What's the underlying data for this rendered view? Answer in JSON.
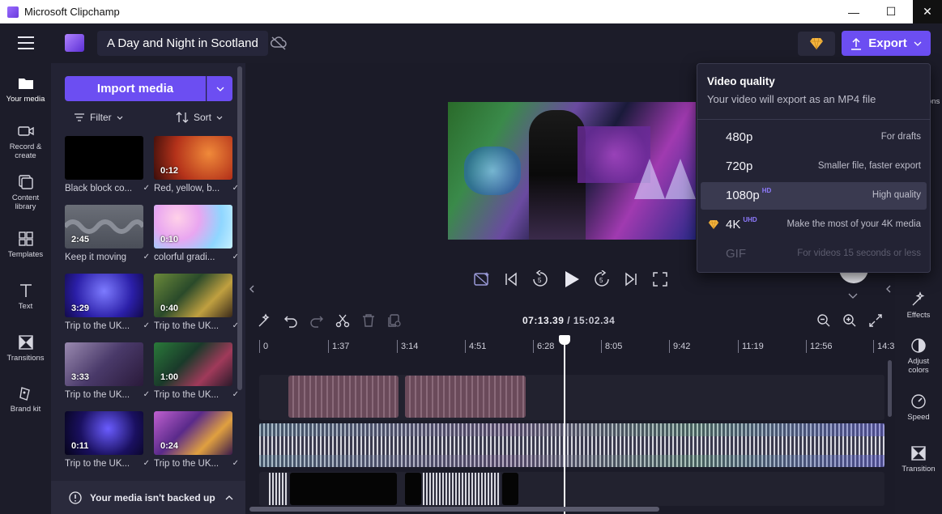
{
  "window": {
    "title": "Microsoft Clipchamp",
    "minimize_glyph": "—",
    "maximize_glyph": "☐",
    "close_glyph": "✕"
  },
  "header": {
    "project_title": "A Day and Night in Scotland",
    "export_label": "Export"
  },
  "leftnav": {
    "items": [
      {
        "label": "Your media",
        "icon": "folder-icon"
      },
      {
        "label": "Record & create",
        "icon": "camera-icon"
      },
      {
        "label": "Content library",
        "icon": "library-icon"
      },
      {
        "label": "Templates",
        "icon": "templates-icon"
      },
      {
        "label": "Text",
        "icon": "text-icon"
      },
      {
        "label": "Transitions",
        "icon": "transitions-icon"
      },
      {
        "label": "Brand kit",
        "icon": "brand-kit-icon"
      }
    ]
  },
  "media": {
    "import_label": "Import media",
    "filter_label": "Filter",
    "sort_label": "Sort",
    "items": [
      {
        "label": "Black block co...",
        "duration": ""
      },
      {
        "label": "Red, yellow, b...",
        "duration": "0:12"
      },
      {
        "label": "Keep it moving",
        "duration": "2:45"
      },
      {
        "label": "colorful gradi...",
        "duration": "0:10"
      },
      {
        "label": "Trip to the UK...",
        "duration": "3:29"
      },
      {
        "label": "Trip to the UK...",
        "duration": "0:40"
      },
      {
        "label": "Trip to the UK...",
        "duration": "3:33"
      },
      {
        "label": "Trip to the UK...",
        "duration": "1:00"
      },
      {
        "label": "Trip to the UK...",
        "duration": "0:11"
      },
      {
        "label": "Trip to the UK...",
        "duration": "0:24"
      }
    ],
    "backup_text": "Your media isn't backed up"
  },
  "timeline": {
    "current_time": "07:13.39",
    "total_time": " / 15:02.34",
    "ruler_labels": [
      "0",
      "1:37",
      "3:14",
      "4:51",
      "6:28",
      "8:05",
      "9:42",
      "11:19",
      "12:56",
      "14:3"
    ]
  },
  "rightpanel": {
    "items": [
      {
        "label": "Effects",
        "icon": "effects-icon"
      },
      {
        "label": "Adjust colors",
        "icon": "adjust-colors-icon"
      },
      {
        "label": "Speed",
        "icon": "speed-icon"
      },
      {
        "label": "Transition",
        "icon": "transition-icon"
      }
    ],
    "partial_label": "ons"
  },
  "export_menu": {
    "title": "Video quality",
    "subtitle": "Your video will export as an MP4 file",
    "options": [
      {
        "quality": "480p",
        "badge": "",
        "desc": "For drafts",
        "selected": false,
        "disabled": false,
        "premium": false
      },
      {
        "quality": "720p",
        "badge": "",
        "desc": "Smaller file, faster export",
        "selected": false,
        "disabled": false,
        "premium": false
      },
      {
        "quality": "1080p",
        "badge": "HD",
        "desc": "High quality",
        "selected": true,
        "disabled": false,
        "premium": false
      },
      {
        "quality": "4K",
        "badge": "UHD",
        "desc": "Make the most of your 4K media",
        "selected": false,
        "disabled": false,
        "premium": true
      },
      {
        "quality": "GIF",
        "badge": "",
        "desc": "For videos 15 seconds or less",
        "selected": false,
        "disabled": true,
        "premium": false
      }
    ]
  },
  "colors": {
    "accent": "#6c4ef2",
    "premium_gem": "#f5b53f",
    "badge": "#8f7bff"
  }
}
